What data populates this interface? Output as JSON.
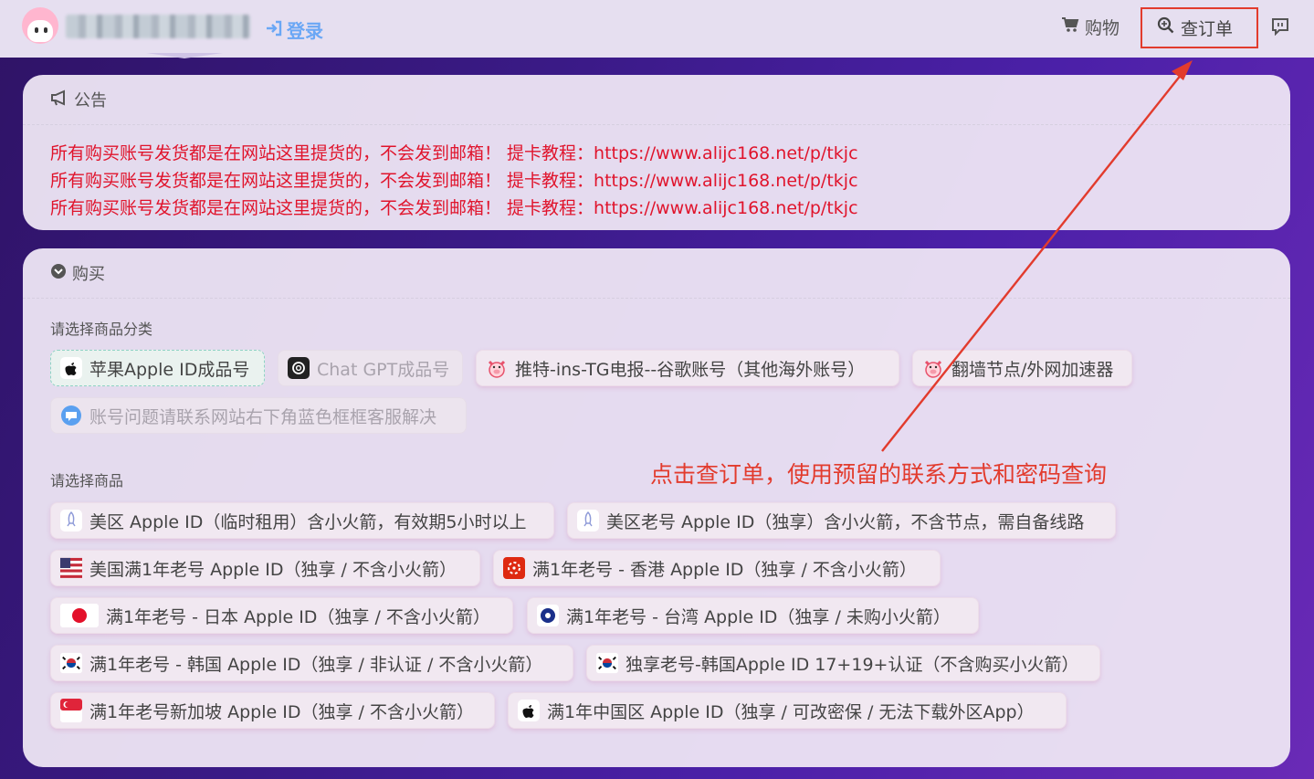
{
  "header": {
    "login_label": "登录",
    "nav_shop": "购物",
    "nav_order": "查订单"
  },
  "notice": {
    "title": "公告",
    "lines": [
      "所有购买账号发货都是在网站这里提货的，不会发到邮箱！ 提卡教程：https://www.alijc168.net/p/tkjc",
      "所有购买账号发货都是在网站这里提货的，不会发到邮箱！ 提卡教程：https://www.alijc168.net/p/tkjc",
      "所有购买账号发货都是在网站这里提货的，不会发到邮箱！ 提卡教程：https://www.alijc168.net/p/tkjc"
    ]
  },
  "buy": {
    "title": "购买",
    "category_label": "请选择商品分类",
    "categories": [
      "苹果Apple ID成品号",
      "Chat GPT成品号",
      "推特-ins-TG电报--谷歌账号（其他海外账号）",
      "翻墙节点/外网加速器",
      "账号问题请联系网站右下角蓝色框框客服解决"
    ],
    "product_label": "请选择商品",
    "products": [
      "美区 Apple ID（临时租用）含小火箭，有效期5小时以上",
      "美区老号 Apple ID（独享）含小火箭，不含节点，需自备线路",
      "美国满1年老号 Apple ID（独享 / 不含小火箭）",
      "满1年老号 - 香港 Apple ID（独享 / 不含小火箭）",
      "满1年老号 - 日本 Apple ID（独享 / 不含小火箭）",
      "满1年老号 - 台湾 Apple ID（独享 / 未购小火箭）",
      "满1年老号 - 韩国 Apple ID（独享 / 非认证 / 不含小火箭）",
      "独享老号-韩国Apple ID 17+19+认证（不含购买小火箭）",
      "满1年老号新加坡 Apple ID（独享 / 不含小火箭）",
      "满1年中国区 Apple ID（独享 / 可改密保 / 无法下载外区App）"
    ]
  },
  "annotation": "点击查订单，使用预留的联系方式和密码查询",
  "colors": {
    "accent_red": "#e23b2d",
    "notice_red": "#e0142c",
    "login_blue": "#6aa7f5"
  }
}
